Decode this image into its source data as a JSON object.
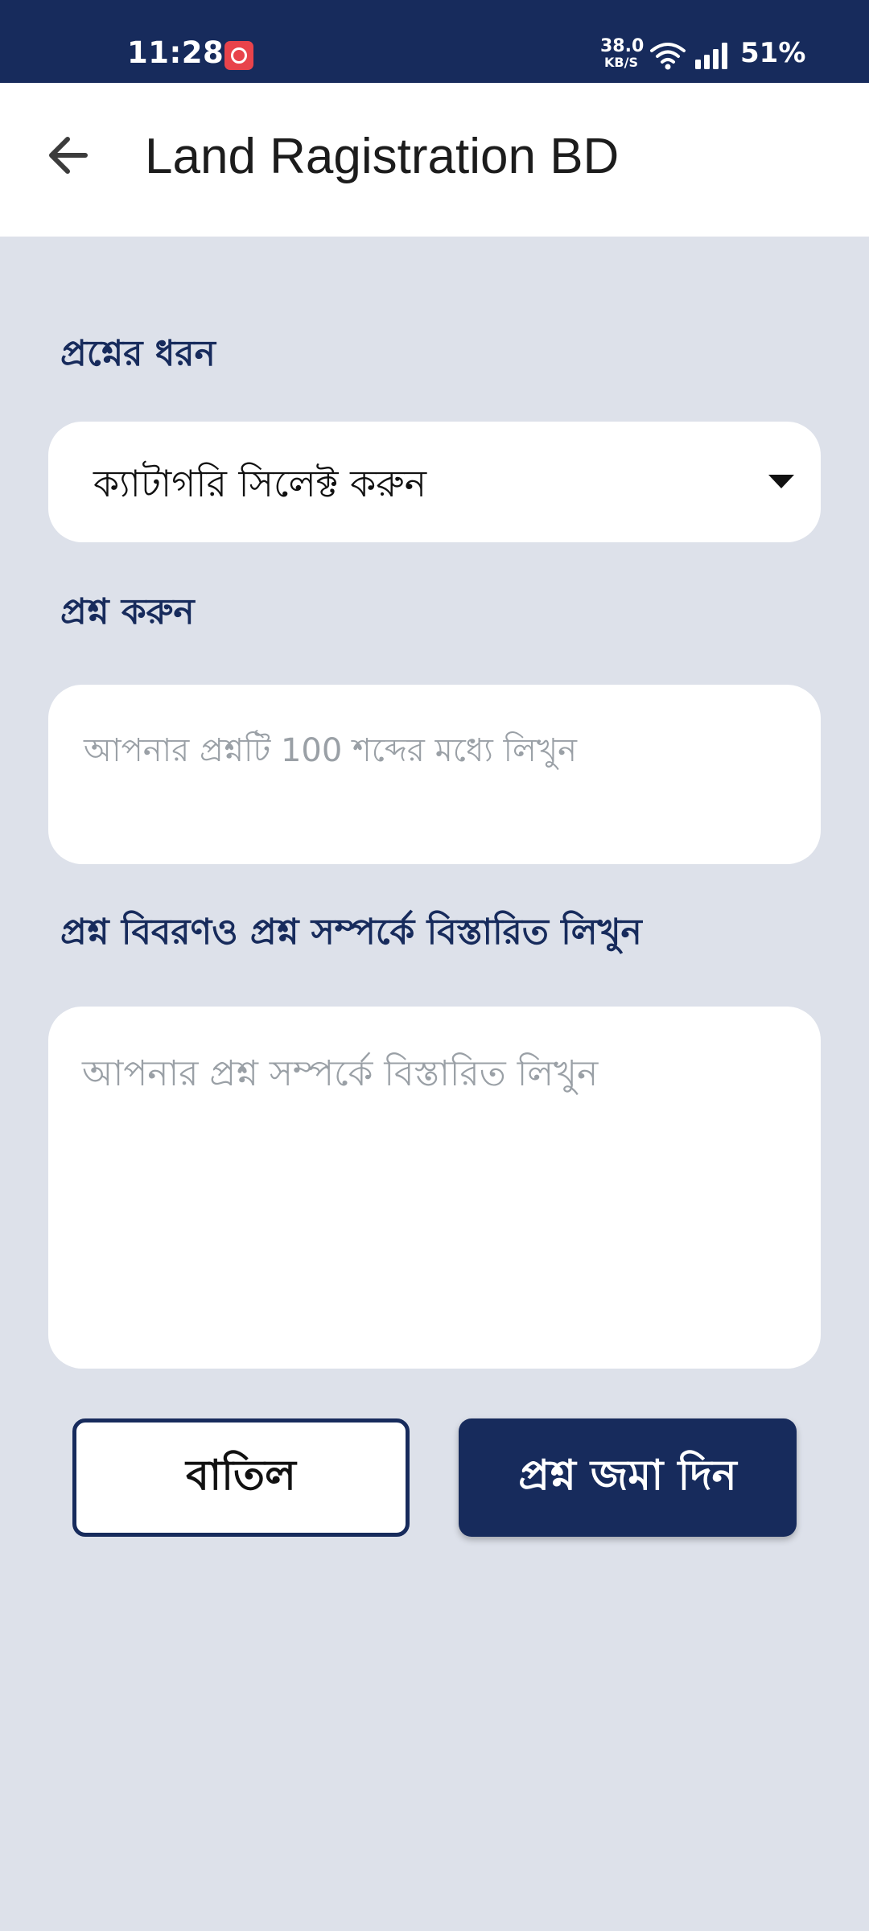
{
  "status_bar": {
    "time": "11:28",
    "net_speed_value": "38.0",
    "net_speed_unit": "KB/S",
    "battery": "51%",
    "app_icon": "alarm-app-icon",
    "wifi_icon": "wifi-icon",
    "signal_icon": "cell-signal-icon",
    "background_color": "#172b5c"
  },
  "app_bar": {
    "back_icon": "arrow-left-icon",
    "title": "Land Ragistration BD"
  },
  "form": {
    "category_label": "প্রশ্নের ধরন",
    "category_dropdown": {
      "selected": "ক্যাটাগরি সিলেক্ট করুন",
      "icon": "dropdown-arrow-icon"
    },
    "question_label": "প্রশ্ন করুন",
    "question_input": {
      "value": "",
      "placeholder": "আপনার প্রশ্নটি 100 শব্দের মধ্যে লিখুন"
    },
    "details_label": "প্রশ্ন বিবরণও প্রশ্ন সম্পর্কে বিস্তারিত লিখুন",
    "details_input": {
      "value": "",
      "placeholder": "আপনার প্রশ্ন সম্পর্কে বিস্তারিত লিখুন"
    }
  },
  "actions": {
    "cancel_label": "বাতিল",
    "submit_label": "প্রশ্ন জমা দিন"
  },
  "colors": {
    "primary": "#172b5c",
    "page_background": "#dde1ea",
    "surface": "#ffffff",
    "placeholder": "#9aa0a6"
  }
}
